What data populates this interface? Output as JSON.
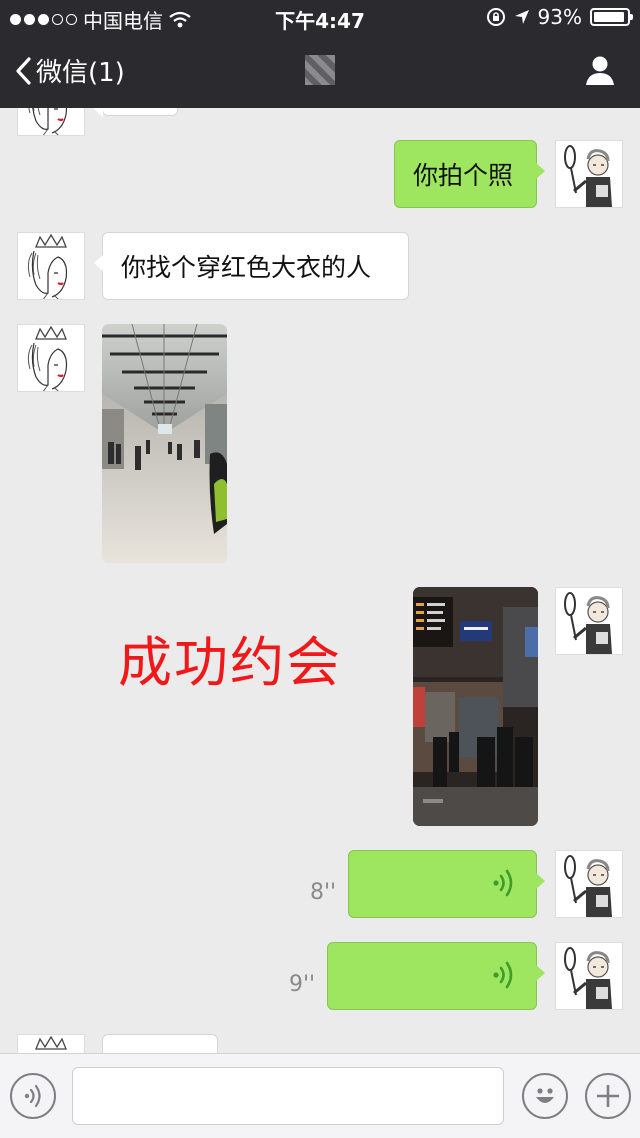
{
  "status_bar": {
    "carrier": "中国电信",
    "time": "下午4:47",
    "battery": "93%",
    "battery_level": 0.93
  },
  "nav": {
    "back_label": "微信(1)",
    "profile_icon": "person-icon"
  },
  "messages": [
    {
      "from": "self",
      "type": "text",
      "text": "你拍个照"
    },
    {
      "from": "other",
      "type": "text",
      "text": "你找个穿红色大衣的人"
    },
    {
      "from": "other",
      "type": "image",
      "subject": "station-hall-photo"
    },
    {
      "from": "self",
      "type": "image",
      "subject": "station-exit-photo"
    },
    {
      "from": "self",
      "type": "voice",
      "duration": "8''"
    },
    {
      "from": "self",
      "type": "voice",
      "duration": "9''"
    }
  ],
  "overlay_text": "成功约会",
  "input_bar": {
    "voice_icon": "voice-toggle-icon",
    "emoji_icon": "emoji-icon",
    "plus_icon": "plus-icon"
  },
  "colors": {
    "header": "#2b2b2f",
    "outgoing_bubble": "#9ee65f",
    "incoming_bubble": "#ffffff",
    "overlay": "#f01818"
  }
}
